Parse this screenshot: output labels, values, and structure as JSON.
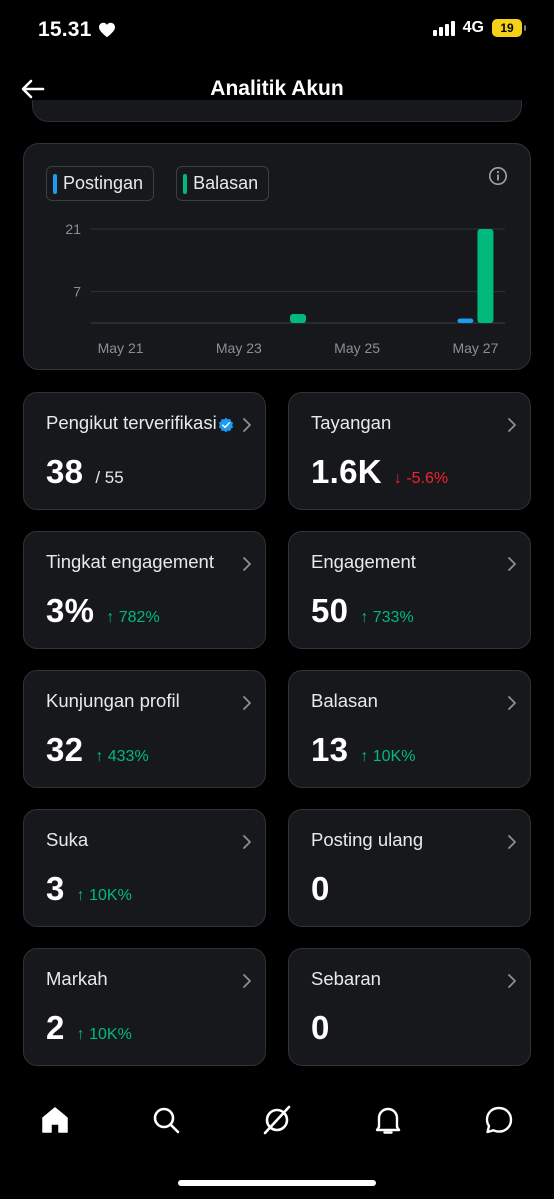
{
  "status_bar": {
    "time": "15.31",
    "network": "4G",
    "battery": "19"
  },
  "header": {
    "title": "Analitik Akun"
  },
  "chart_data": {
    "type": "bar",
    "categories": [
      "May 21",
      "May 22",
      "May 23",
      "May 24",
      "May 25",
      "May 26",
      "May 27"
    ],
    "x_tick_labels": [
      "May 21",
      "May 23",
      "May 25",
      "May 27"
    ],
    "series": [
      {
        "name": "Postingan",
        "values": [
          0,
          0,
          0,
          0,
          0,
          0,
          1
        ],
        "color": "#1d9bf0"
      },
      {
        "name": "Balasan",
        "values": [
          0,
          0,
          0,
          2,
          0,
          0,
          21
        ],
        "color": "#00ba7c"
      }
    ],
    "y_ticks": [
      "7",
      "21"
    ],
    "ylim": [
      0,
      21
    ],
    "grid": true,
    "legend_position": "top-left"
  },
  "stats": [
    {
      "label": "Pengikut terverifikasi",
      "value": "38",
      "total": "/ 55",
      "change": "",
      "verified": true
    },
    {
      "label": "Tayangan",
      "value": "1.6K",
      "change": "↓ -5.6%",
      "direction": "down"
    },
    {
      "label": "Tingkat engagement",
      "value": "3%",
      "change": "↑ 782%",
      "direction": "up"
    },
    {
      "label": "Engagement",
      "value": "50",
      "change": "↑ 733%",
      "direction": "up"
    },
    {
      "label": "Kunjungan profil",
      "value": "32",
      "change": "↑ 433%",
      "direction": "up"
    },
    {
      "label": "Balasan",
      "value": "13",
      "change": "↑ 10K%",
      "direction": "up"
    },
    {
      "label": "Suka",
      "value": "3",
      "change": "↑ 10K%",
      "direction": "up"
    },
    {
      "label": "Posting ulang",
      "value": "0",
      "change": "",
      "direction": "none"
    },
    {
      "label": "Markah",
      "value": "2",
      "change": "↑ 10K%",
      "direction": "up"
    },
    {
      "label": "Sebaran",
      "value": "0",
      "change": "",
      "direction": "none"
    }
  ],
  "nav": {
    "items": [
      {
        "icon": "home-icon"
      },
      {
        "icon": "search-icon"
      },
      {
        "icon": "grok-icon"
      },
      {
        "icon": "notifications-icon"
      },
      {
        "icon": "messages-icon"
      }
    ]
  }
}
